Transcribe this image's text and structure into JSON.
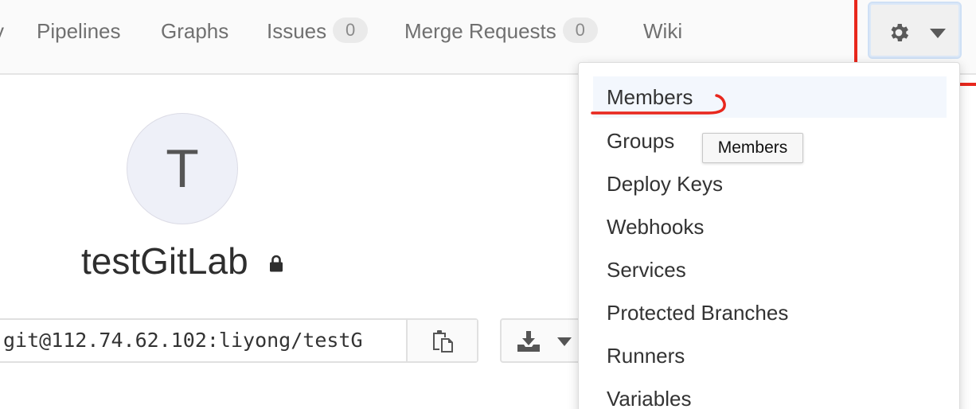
{
  "nav": {
    "partial_label": "y",
    "items": [
      {
        "label": "Pipelines"
      },
      {
        "label": "Graphs"
      },
      {
        "label": "Issues",
        "badge": "0"
      },
      {
        "label": "Merge Requests",
        "badge": "0"
      },
      {
        "label": "Wiki"
      }
    ],
    "settings": {
      "icon": "gear-icon",
      "caret": "chevron-down-icon"
    }
  },
  "project": {
    "avatar_letter": "T",
    "name": "testGitLab",
    "visibility_icon": "lock-icon",
    "clone_url": "git@112.74.62.102:liyong/testG",
    "copy_icon": "clipboard-icon",
    "download_icon": "download-icon"
  },
  "dropdown": {
    "items": [
      {
        "label": "Members"
      },
      {
        "label": "Groups"
      },
      {
        "label": "Deploy Keys"
      },
      {
        "label": "Webhooks"
      },
      {
        "label": "Services"
      },
      {
        "label": "Protected Branches"
      },
      {
        "label": "Runners"
      },
      {
        "label": "Variables"
      }
    ],
    "tooltip": "Members"
  },
  "colors": {
    "annotation_red": "#e8271d",
    "nav_bg": "#fafafa",
    "hover_bg": "#f3f7fd"
  }
}
